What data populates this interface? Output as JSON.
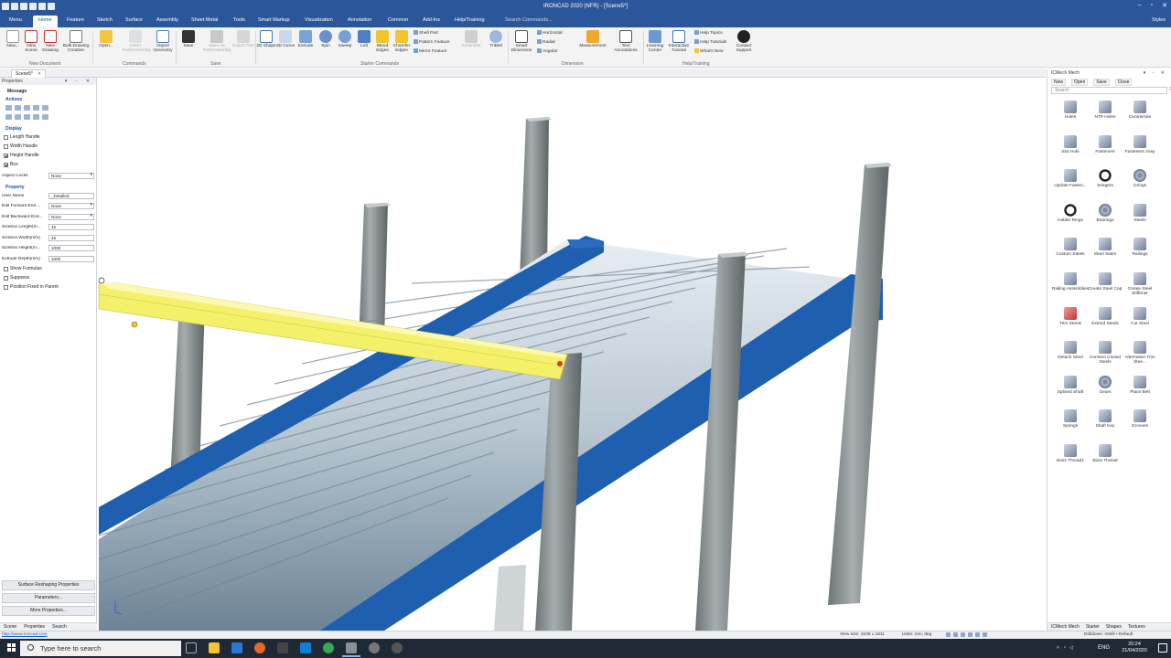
{
  "window": {
    "title": "IRONCAD 2020 (NFR) - [Scene5*]",
    "controls": [
      "–",
      "▫",
      "✕"
    ]
  },
  "ribbon_tabs": [
    "Menu",
    "Home",
    "Feature",
    "Sketch",
    "Surface",
    "Assembly",
    "Sheet Metal",
    "Tools",
    "Smart Markup",
    "Visualization",
    "Annotation",
    "Common",
    "Add-Ins",
    "Help/Training"
  ],
  "active_tab": "Home",
  "command_search": "Search Commands...",
  "styles_label": "Styles",
  "ribbon": {
    "new_document": {
      "group": "New Document",
      "buttons": [
        "New...",
        "New Scene",
        "New Drawing",
        "Bulk Drawing Creation"
      ]
    },
    "commands": {
      "group": "Commands",
      "buttons": [
        "Open...",
        "Insert Part/Assembly",
        "Import Geometry"
      ]
    },
    "save": {
      "group": "Save",
      "buttons": [
        "Save",
        "Save As Part/Assembly",
        "Export Part"
      ]
    },
    "starter": {
      "group": "Starter Commands",
      "buttons": [
        "2D Shape",
        "3D Curve",
        "Extrude",
        "Spin",
        "Sweep",
        "Loft",
        "Blend Edges",
        "Chamfer Edges"
      ],
      "small": [
        "Shell Part",
        "Pattern Feature",
        "Mirror Feature"
      ],
      "extra": [
        "Assemble",
        "TriBall"
      ]
    },
    "dimension": {
      "group": "Dimension",
      "buttons": [
        "Smart Dimension",
        "Measurement",
        "Text Annotations"
      ],
      "small": [
        "Horizontal",
        "Radial",
        "Angular"
      ]
    },
    "help": {
      "group": "Help/Training",
      "buttons": [
        "Learning Center",
        "Interactive Tutorial",
        "Contact Support"
      ],
      "small": [
        "Help Topics",
        "Help Tutorials",
        "What's New"
      ]
    }
  },
  "document_tab": {
    "label": "Scene5*",
    "close": "✕"
  },
  "properties_panel": {
    "title": "Properties",
    "message": "Message",
    "actions_label": "Actions",
    "display_label": "Display",
    "display_checks": [
      {
        "label": "Length Handle",
        "checked": false
      },
      {
        "label": "Width Handle",
        "checked": false
      },
      {
        "label": "Height Handle",
        "checked": true
      },
      {
        "label": "Box",
        "checked": true
      }
    ],
    "aspect_locks": {
      "label": "Aspect Locks",
      "value": "None"
    },
    "property_label": "Property",
    "fields": [
      {
        "label": "User Name",
        "value": "_Detailed",
        "dropdown": false
      },
      {
        "label": "Edit Forward End ...",
        "value": "None",
        "dropdown": true
      },
      {
        "label": "Edit Backward End...",
        "value": "None",
        "dropdown": true
      },
      {
        "label": "Sizebox Length(m...",
        "value": "45",
        "dropdown": false
      },
      {
        "label": "Sizebox Width(mm)",
        "value": "45",
        "dropdown": false
      },
      {
        "label": "Sizebox Height(m...",
        "value": "1000",
        "dropdown": false
      },
      {
        "label": "Extrude Depth(mm)",
        "value": "1000",
        "dropdown": false
      }
    ],
    "option_checks": [
      {
        "label": "Show Formulas",
        "checked": false
      },
      {
        "label": "Suppress",
        "checked": false
      },
      {
        "label": "Position Fixed in Parent",
        "checked": false
      }
    ],
    "buttons": [
      "Surface Reshaping Properties",
      "Parameters...",
      "More Properties..."
    ],
    "bottom_tabs": [
      "Scene",
      "Properties",
      "Search"
    ]
  },
  "catalog_panel": {
    "title": "ICMech Mech",
    "toolbar": [
      "New",
      "Open",
      "Save",
      "Close"
    ],
    "search_placeholder": "Search",
    "items": [
      "Holes",
      "NTP Holes",
      "CentreHole",
      "Slot Hole",
      "Fasteners",
      "Fasteners Assy",
      "Update Fasten...",
      "Seegers",
      "Orings",
      "Holder Rings",
      "Bearings",
      "Steels",
      "Custom Steels",
      "Steel Stairs",
      "Railings",
      "Railing Assemblies",
      "Create Steel Cap",
      "Create Steel Stiffener",
      "Trim Steels",
      "Extend Steels",
      "Cut Steel",
      "Detach Steel",
      "Connect Closed Steels",
      "Alternative Trim Stee...",
      "Splined Shaft",
      "Gears",
      "Place Belt",
      "Springs",
      "Shaft Key",
      "Grooves",
      "Boss Thread1",
      "Boss Thread"
    ],
    "bottom_tabs": [
      "ICMech Mech",
      "Starter",
      "Shapes",
      "Textures"
    ]
  },
  "statusbar": {
    "link": "http://www.ironcad.com",
    "view_size": "View size: 3106 x 1811",
    "units": "Units: mm, deg",
    "drilldown": "Drilldown: Intelli • Default"
  },
  "taskbar": {
    "search_placeholder": "Type here to search",
    "language": "ENG",
    "time": "20:24",
    "date": "21/04/2020"
  },
  "colors": {
    "accent": "#2b579a",
    "conveyor_frame": "#1f5fb0",
    "selected_beam": "#f5f06a",
    "column": "#8f9698"
  }
}
